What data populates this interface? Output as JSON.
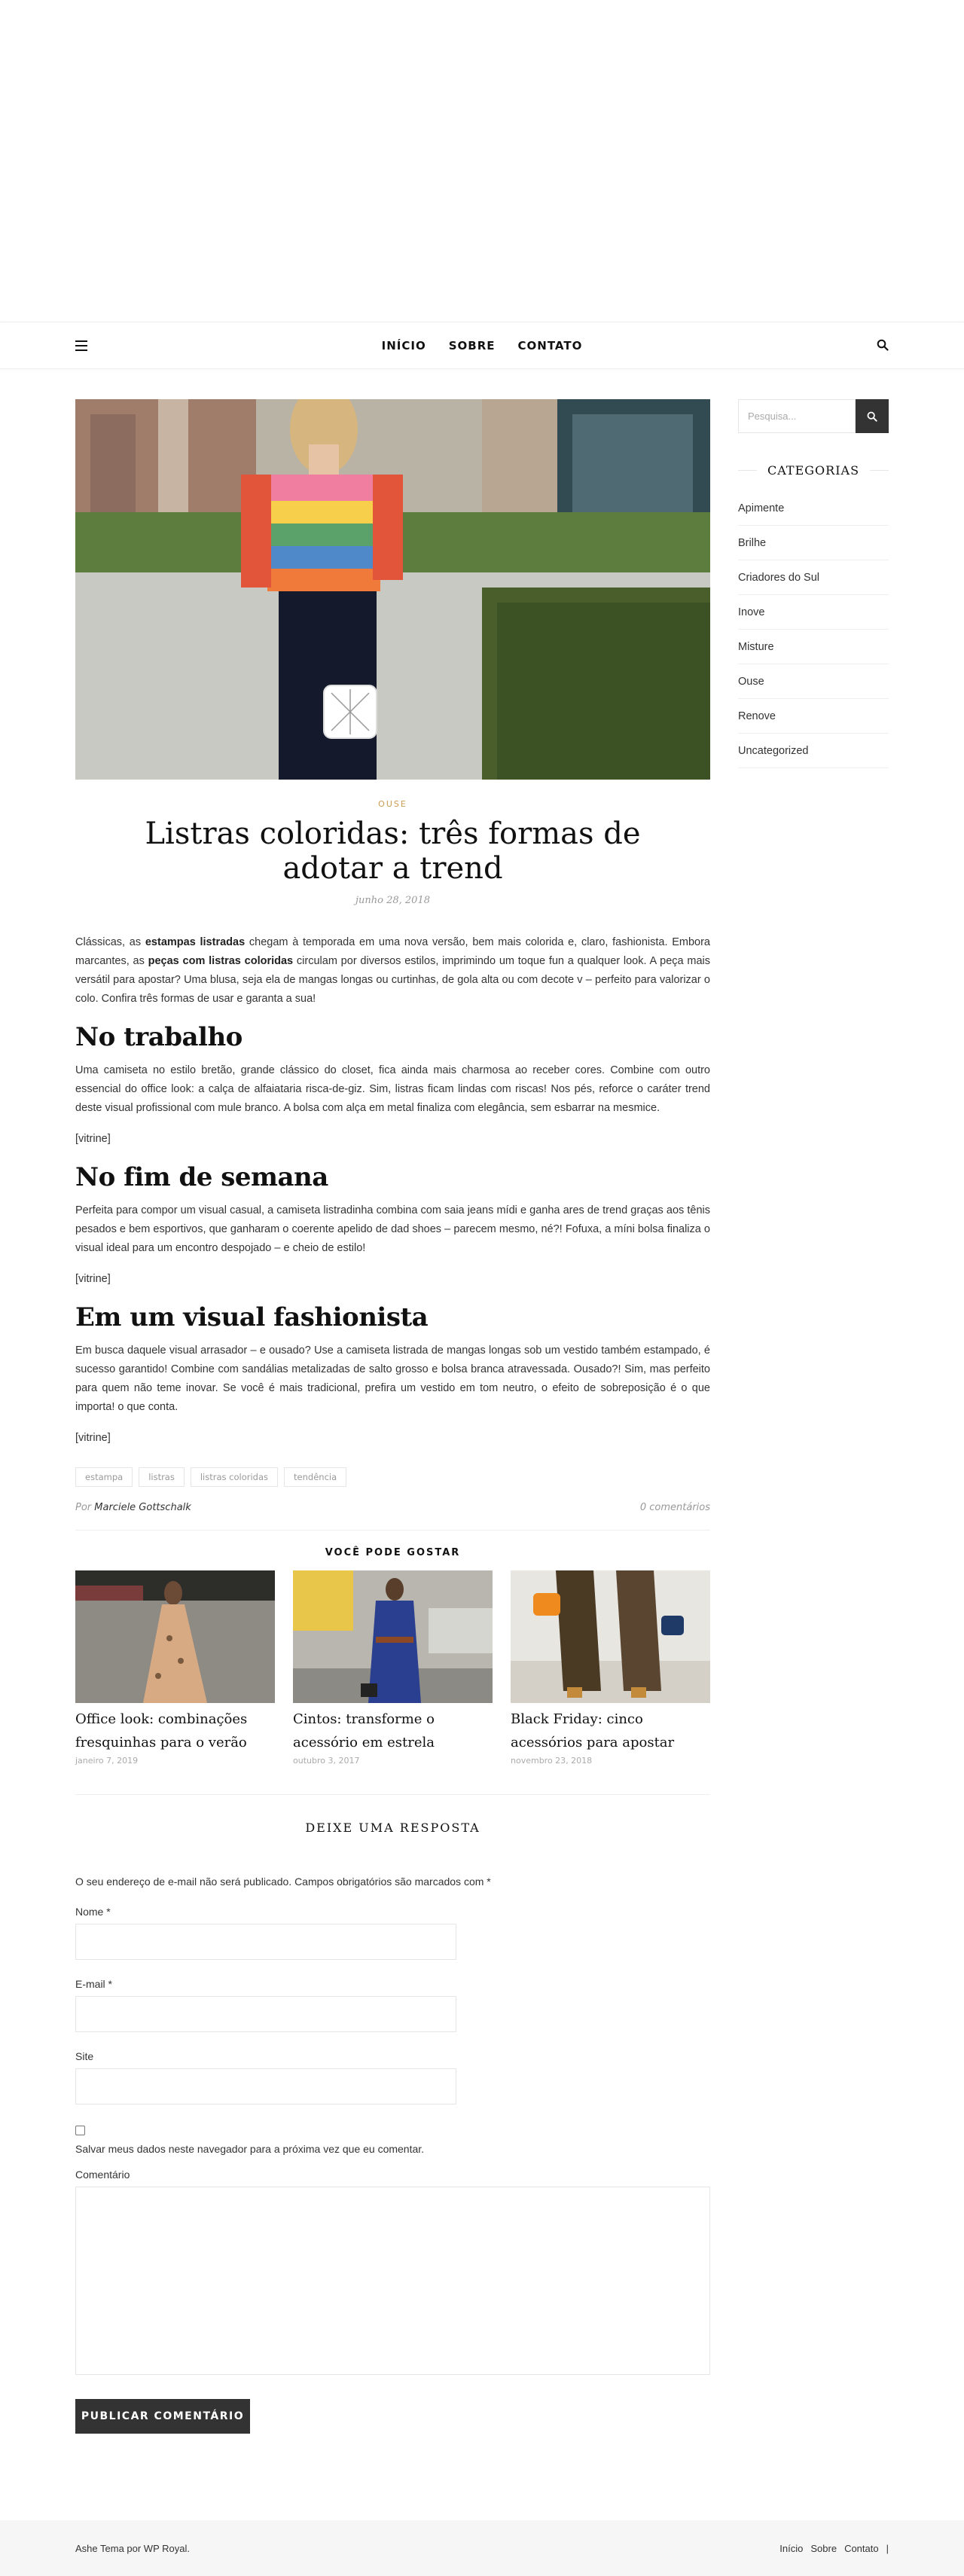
{
  "nav": {
    "items": [
      "INÍCIO",
      "SOBRE",
      "CONTATO"
    ]
  },
  "post": {
    "category": "OUSE",
    "title": "Listras coloridas: três formas de adotar a trend",
    "date": "junho 28, 2018",
    "intro_p1": "Clássicas, as ",
    "intro_b1": "estampas listradas",
    "intro_p2": " chegam à temporada em uma nova versão, bem mais colorida e, claro, fashionista. Embora marcantes, as ",
    "intro_b2": "peças com listras coloridas",
    "intro_p3": " circulam por diversos estilos, imprimindo um toque fun a qualquer look. A peça mais versátil para apostar? Uma blusa, seja ela de mangas longas ou curtinhas, de gola alta ou com decote v – perfeito para valorizar o colo. Confira três formas de usar e garanta a sua!",
    "h_work": "No trabalho",
    "p_work": "Uma camiseta no estilo bretão, grande clássico do closet, fica ainda mais charmosa ao receber cores. Combine com outro essencial do office look: a calça de alfaiataria risca-de-giz. Sim, listras ficam lindas com riscas! Nos pés, reforce o caráter trend deste visual profissional com mule branco. A bolsa com alça em metal finaliza com elegância, sem esbarrar na mesmice.",
    "vitrine1": "[vitrine]",
    "h_weekend": "No fim de semana",
    "p_weekend": "Perfeita para compor um visual casual, a camiseta listradinha combina com saia jeans mídi e ganha ares de trend graças aos tênis pesados e bem esportivos, que ganharam o coerente apelido de dad shoes – parecem mesmo, né?! Fofuxa, a míni bolsa finaliza o visual ideal para um encontro despojado – e cheio de estilo!",
    "vitrine2": "[vitrine]",
    "h_fashion": "Em um visual fashionista",
    "p_fashion": "Em busca daquele visual arrasador – e ousado? Use a camiseta listrada de mangas longas sob um vestido também estampado, é sucesso garantido! Combine com sandálias metalizadas de salto grosso e bolsa branca atravessada. Ousado?! Sim, mas perfeito para quem não teme inovar. Se você é mais tradicional, prefira um vestido em tom neutro, o efeito de sobreposição é o que importa! o que conta.",
    "vitrine3": "[vitrine]",
    "tags": [
      "estampa",
      "listras",
      "listras coloridas",
      "tendência"
    ],
    "author_prefix": "Por",
    "author": "Marciele Gottschalk",
    "comments": "0 comentários"
  },
  "related": {
    "title": "VOCÊ PODE GOSTAR",
    "items": [
      {
        "title": "Office look: combinações fresquinhas para o verão",
        "date": "janeiro 7, 2019"
      },
      {
        "title": "Cintos: transforme o acessório em estrela",
        "date": "outubro 3, 2017"
      },
      {
        "title": "Black Friday: cinco acessórios para apostar",
        "date": "novembro 23, 2018"
      }
    ]
  },
  "reply": {
    "title": "DEIXE UMA RESPOSTA",
    "note": "O seu endereço de e-mail não será publicado. Campos obrigatórios são marcados com *",
    "name_label": "Nome *",
    "email_label": "E-mail *",
    "site_label": "Site",
    "save_label": "Salvar meus dados neste navegador para a próxima vez que eu comentar.",
    "comment_label": "Comentário",
    "submit": "PUBLICAR COMENTÁRIO"
  },
  "sidebar": {
    "search_placeholder": "Pesquisa...",
    "categories_title": "CATEGORIAS",
    "categories": [
      "Apimente",
      "Brilhe",
      "Criadores do Sul",
      "Inove",
      "Misture",
      "Ouse",
      "Renove",
      "Uncategorized"
    ]
  },
  "footer": {
    "credit": "Ashe Tema por WP Royal.",
    "links": [
      "Início",
      "Sobre",
      "Contato"
    ],
    "separator": "|"
  },
  "colors": {
    "accent": "#ca9b52",
    "dark": "#333333"
  }
}
